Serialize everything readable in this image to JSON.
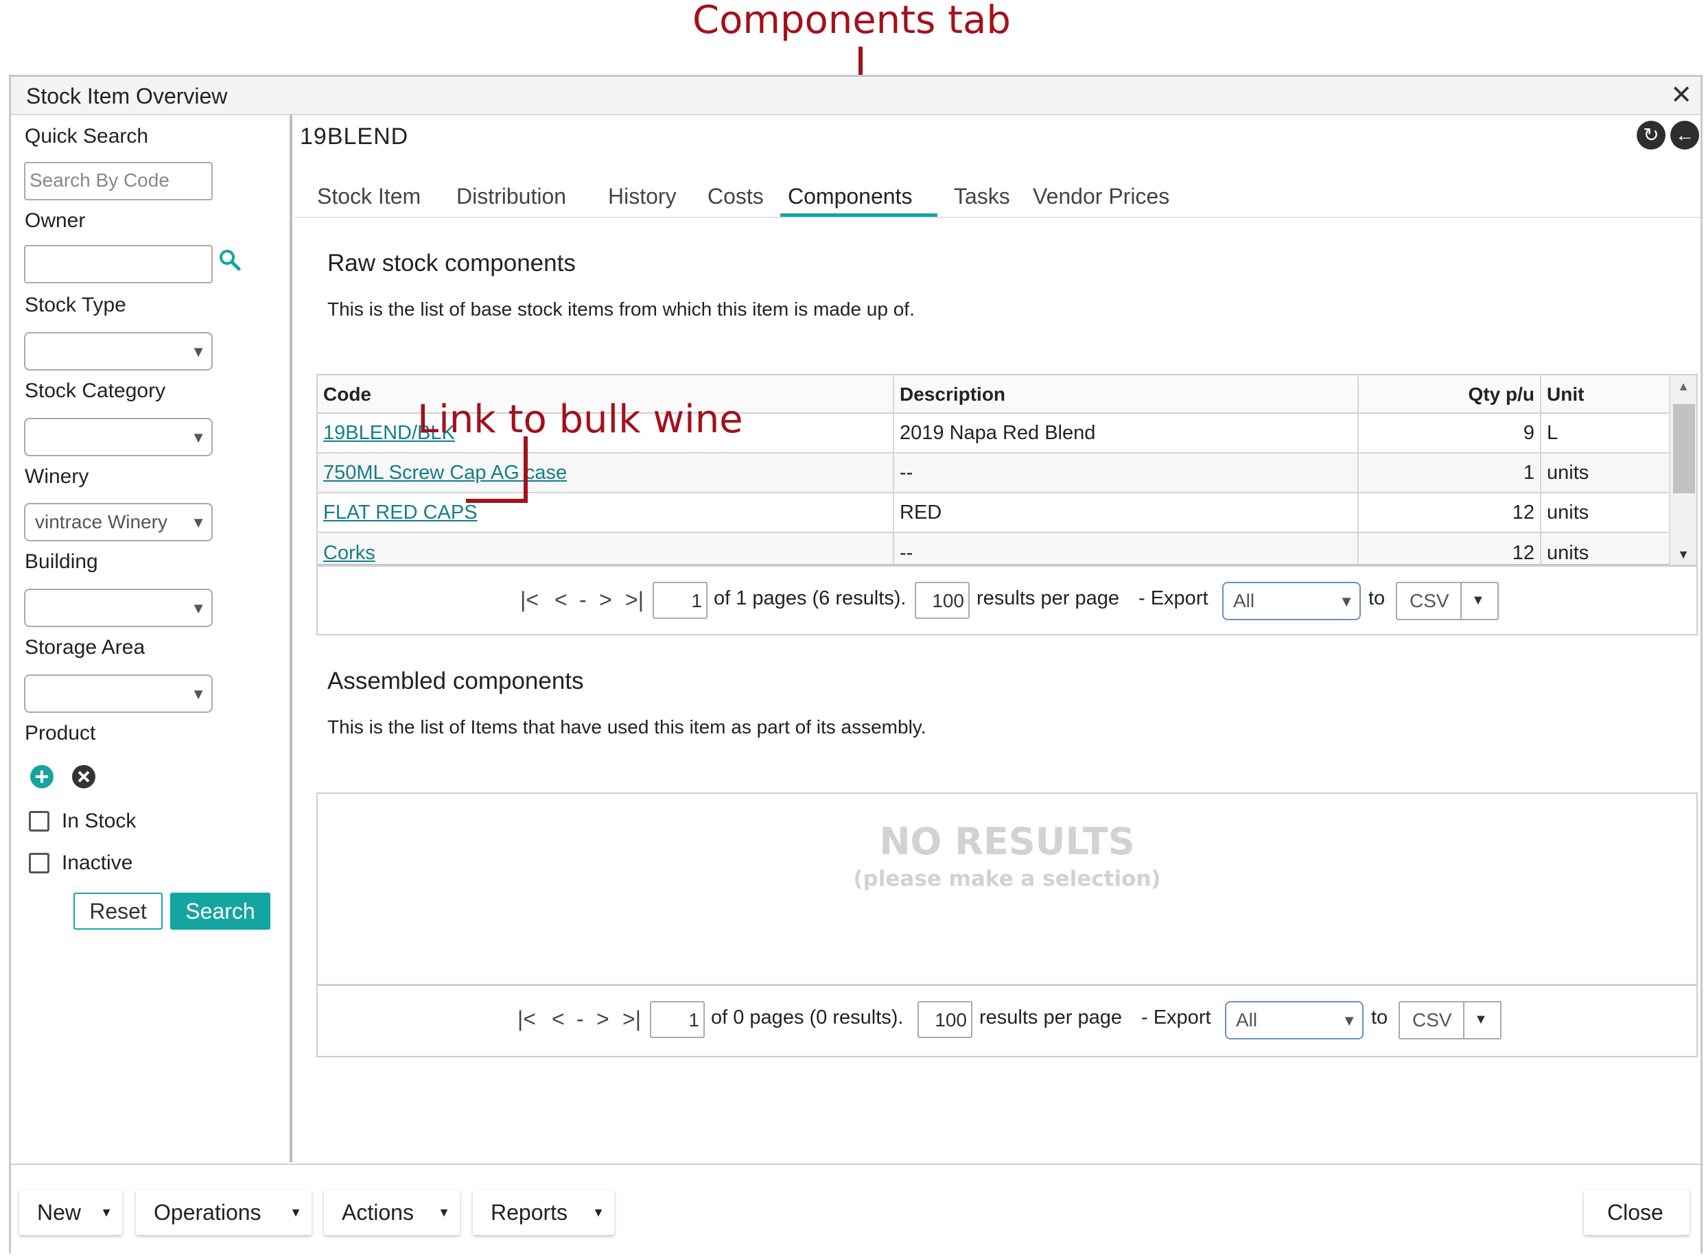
{
  "annotations": {
    "components_tab": "Components tab",
    "link_to_bulk_wine": "Link to bulk wine"
  },
  "window": {
    "title": "Stock Item Overview",
    "close_icon": "close-icon"
  },
  "sidebar": {
    "quick_search_label": "Quick Search",
    "search_by_code_placeholder": "Search By Code",
    "owner_label": "Owner",
    "owner_value": "",
    "stock_type_label": "Stock Type",
    "stock_type_value": "",
    "stock_category_label": "Stock Category",
    "stock_category_value": "",
    "winery_label": "Winery",
    "winery_value": "vintrace Winery",
    "building_label": "Building",
    "building_value": "",
    "storage_area_label": "Storage Area",
    "storage_area_value": "",
    "product_label": "Product",
    "in_stock_label": "In Stock",
    "inactive_label": "Inactive",
    "reset_label": "Reset",
    "search_label": "Search",
    "accent_color": "#14a5a0"
  },
  "main": {
    "item_code": "19BLEND",
    "tabs": [
      {
        "label": "Stock Item"
      },
      {
        "label": "Distribution"
      },
      {
        "label": "History"
      },
      {
        "label": "Costs"
      },
      {
        "label": "Components",
        "active": true
      },
      {
        "label": "Tasks"
      },
      {
        "label": "Vendor Prices"
      }
    ],
    "raw": {
      "title": "Raw stock components",
      "description": "This is the list of base stock items from which this item is made up of.",
      "columns": [
        "Code",
        "Description",
        "Qty p/u",
        "Unit"
      ],
      "rows": [
        {
          "code": "19BLEND/BLK",
          "description": "2019 Napa Red Blend",
          "qty": "9",
          "unit": "L"
        },
        {
          "code": "750ML Screw Cap AG case",
          "description": "--",
          "qty": "1",
          "unit": "units"
        },
        {
          "code": "FLAT RED CAPS",
          "description": "RED",
          "qty": "12",
          "unit": "units"
        },
        {
          "code": "Corks",
          "description": "--",
          "qty": "12",
          "unit": "units"
        }
      ],
      "pager": {
        "page": "1",
        "summary": "of 1 pages (6 results).",
        "per_page": "100",
        "per_page_label": "results per page",
        "export_label": "- Export",
        "export_scope": "All",
        "to_label": "to",
        "format": "CSV",
        "dash": "-"
      }
    },
    "assembled": {
      "title": "Assembled components",
      "description": "This is the list of Items that have used this item as part of its assembly.",
      "no_results": "NO RESULTS",
      "no_results_hint": "(please make a selection)",
      "pager": {
        "page": "1",
        "summary": "of 0 pages (0 results).",
        "per_page": "100",
        "per_page_label": "results per page",
        "export_label": "- Export",
        "export_scope": "All",
        "to_label": "to",
        "format": "CSV",
        "dash": "-"
      }
    }
  },
  "footer": {
    "new_label": "New",
    "operations_label": "Operations",
    "actions_label": "Actions",
    "reports_label": "Reports",
    "close_label": "Close"
  }
}
